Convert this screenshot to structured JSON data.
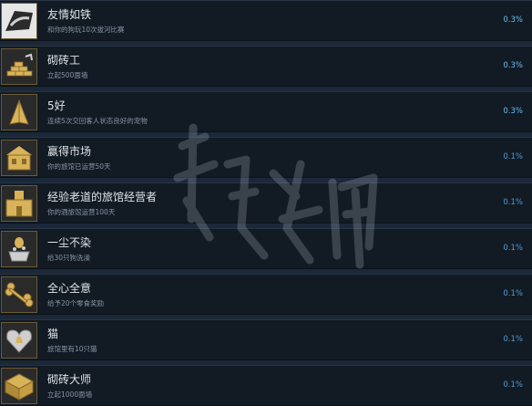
{
  "achievements": [
    {
      "title": "友情如铁",
      "desc": "和你的狗玩10次拔河比赛",
      "pct": "0.3%",
      "icon": "iron-friendship-icon",
      "bg": "#e0e0e0"
    },
    {
      "title": "砌砖工",
      "desc": "立起500面墙",
      "pct": "0.3%",
      "icon": "brick-stack-icon",
      "bg": "#2a2a2a"
    },
    {
      "title": "5好",
      "desc": "连续5次交回客人状态良好的宠物",
      "pct": "0.3%",
      "icon": "praying-hands-icon",
      "bg": "#2a2a2a"
    },
    {
      "title": "赢得市场",
      "desc": "你的旅馆已运营50天",
      "pct": "0.1%",
      "icon": "market-building-icon",
      "bg": "#2a2a2a"
    },
    {
      "title": "经验老道的旅馆经营者",
      "desc": "你的酒旅馆运营100天",
      "pct": "0.1%",
      "icon": "hotel-building-icon",
      "bg": "#2a2a2a"
    },
    {
      "title": "一尘不染",
      "desc": "给30只狗洗澡",
      "pct": "0.1%",
      "icon": "bath-dog-icon",
      "bg": "#2a2a2a"
    },
    {
      "title": "全心全意",
      "desc": "给予20个零食奖励",
      "pct": "0.1%",
      "icon": "bone-treat-icon",
      "bg": "#2a2a2a"
    },
    {
      "title": "猫",
      "desc": "旅馆里有10只猫",
      "pct": "0.1%",
      "icon": "cat-heart-icon",
      "bg": "#2a2a2a"
    },
    {
      "title": "砌砖大师",
      "desc": "立起1000面墙",
      "pct": "0.1%",
      "icon": "brick-master-icon",
      "bg": "#2a2a2a"
    }
  ],
  "colors": {
    "gold": "#d8b35a",
    "gold_dark": "#8a6a28",
    "silver": "#cfcfcf"
  }
}
